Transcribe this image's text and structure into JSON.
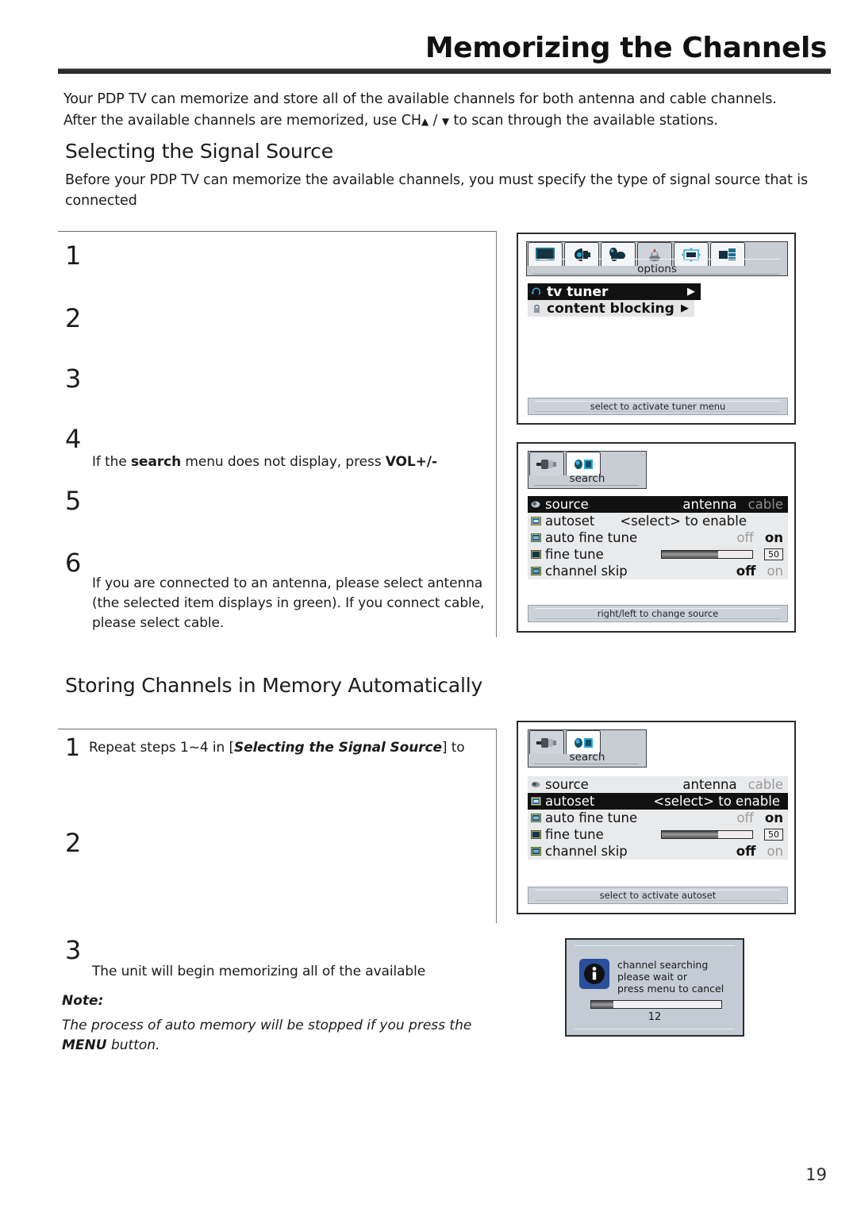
{
  "document": {
    "title": "Memorizing the Channels",
    "page_number": "19",
    "intro_line1": "Your PDP TV can memorize and store all of the available channels for both antenna and cable channels.",
    "intro_line2_a": "After the  available channels are memorized, use CH",
    "intro_line2_b": " / ",
    "intro_line2_c": " to scan through the available stations.",
    "ch_up_glyph": "▲",
    "ch_down_glyph": "▼"
  },
  "sections": {
    "signal_source": {
      "heading": "Selecting the Signal Source",
      "description": "Before your PDP TV can memorize the available channels, you must specify the type of signal source that is connected",
      "steps": [
        {
          "num": "1",
          "text": ""
        },
        {
          "num": "2",
          "text": ""
        },
        {
          "num": "3",
          "text": ""
        },
        {
          "num": "4",
          "text_pre": "If  the  ",
          "text_bold1": "search",
          "text_mid": "  menu  does  not  display,  press  ",
          "text_bold2": "VOL+/-"
        },
        {
          "num": "5",
          "text": ""
        },
        {
          "num": "6",
          "text": "If you are connected to an antenna, please select antenna (the selected item displays in green). If you connect cable, please select cable."
        }
      ]
    },
    "storing_channels": {
      "heading": "Storing Channels in Memory Automatically",
      "steps": [
        {
          "num": "1",
          "text_pre": "Repeat  steps  1~4  in  [",
          "text_bold": "Selecting  the  Signal  Source",
          "text_post": "]  to"
        },
        {
          "num": "2",
          "text": ""
        },
        {
          "num": "3",
          "text": "The  unit  will  begin  memorizing  all  of  the  available"
        }
      ],
      "note_label": "Note:",
      "note_text_a": "The process of auto memory will be stopped if you press the ",
      "note_text_bold": "MENU",
      "note_text_b": " button."
    }
  },
  "osd_options": {
    "tabs": [
      {
        "icon": "tv-display-icon",
        "selected": false
      },
      {
        "icon": "speaker-audio-icon",
        "selected": false
      },
      {
        "icon": "balloons-features-icon",
        "selected": false
      },
      {
        "icon": "options-tuner-icon",
        "selected": true
      },
      {
        "icon": "screen-setup-icon",
        "selected": false
      },
      {
        "icon": "inputs-icon",
        "selected": false
      }
    ],
    "tab_caption": "options",
    "items": [
      {
        "label": "tv tuner",
        "icon": "tuner-icon",
        "arrow": "▶",
        "highlighted": true
      },
      {
        "label": "content blocking",
        "icon": "lock-icon",
        "arrow": "▶",
        "highlighted": false
      }
    ],
    "status": "select to activate tuner menu"
  },
  "osd_search": {
    "tabs": [
      {
        "icon": "plug-connector-icon",
        "selected": false
      },
      {
        "icon": "search-tuner-icon",
        "selected": true
      }
    ],
    "tab_caption": "search",
    "rows": [
      {
        "label": "source",
        "icon": "source-icon",
        "highlighted": true,
        "type": "choice",
        "options": [
          "antenna",
          "cable"
        ],
        "active_index": 0
      },
      {
        "label": "autoset",
        "icon": "autoset-icon",
        "highlighted": false,
        "type": "action",
        "value": "<select> to enable"
      },
      {
        "label": "auto fine tune",
        "icon": "autofinetune-icon",
        "highlighted": false,
        "type": "choice",
        "options": [
          "off",
          "on"
        ],
        "active_index": 1
      },
      {
        "label": "fine tune",
        "icon": "finetune-icon",
        "highlighted": false,
        "type": "slider",
        "value": "50",
        "percent": 62
      },
      {
        "label": "channel skip",
        "icon": "channelskip-icon",
        "highlighted": false,
        "type": "choice",
        "options": [
          "off",
          "on"
        ],
        "active_index": 0
      }
    ],
    "status": "right/left to change source"
  },
  "osd_autoset": {
    "tabs": [
      {
        "icon": "plug-connector-icon",
        "selected": false
      },
      {
        "icon": "search-tuner-icon",
        "selected": true
      }
    ],
    "tab_caption": "search",
    "rows": [
      {
        "label": "source",
        "icon": "source-icon",
        "highlighted": false,
        "type": "choice",
        "options": [
          "antenna",
          "cable"
        ],
        "active_index": 0
      },
      {
        "label": "autoset",
        "icon": "autoset-icon",
        "highlighted": true,
        "type": "action",
        "value": "<select> to enable"
      },
      {
        "label": "auto fine tune",
        "icon": "autofinetune-icon",
        "highlighted": false,
        "type": "choice",
        "options": [
          "off",
          "on"
        ],
        "active_index": 1
      },
      {
        "label": "fine tune",
        "icon": "finetune-icon",
        "highlighted": false,
        "type": "slider",
        "value": "50",
        "percent": 62
      },
      {
        "label": "channel skip",
        "icon": "channelskip-icon",
        "highlighted": false,
        "type": "choice",
        "options": [
          "off",
          "on"
        ],
        "active_index": 0
      }
    ],
    "status": "select to activate autoset"
  },
  "osd_dialog": {
    "icon": "info-icon",
    "line1": "channel searching",
    "line2": "please wait or",
    "line3": "press menu to cancel",
    "progress_percent": 17,
    "count": "12"
  },
  "colors": {
    "highlight_bg": "#111111",
    "menu_bg": "#e9eaec",
    "panel_bg": "#c8cdd4",
    "accent_blue": "#2a4f9b",
    "icon_teal": "#1c6f8f",
    "rule_dark": "#2b2b2b"
  }
}
